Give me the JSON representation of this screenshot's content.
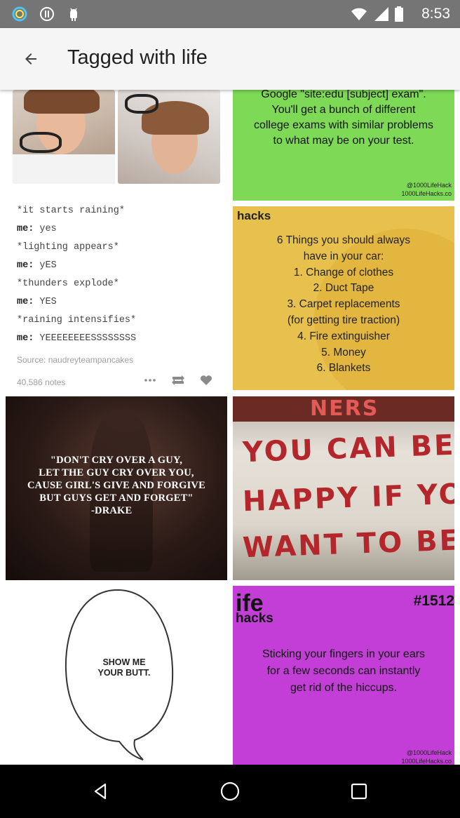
{
  "status_bar": {
    "time": "8:53",
    "icons": [
      "circle-app-icon",
      "pause-circle-icon",
      "android-icon"
    ]
  },
  "app_bar": {
    "back_icon": "arrow-back-icon",
    "title": "Tagged with life"
  },
  "tiles": {
    "green": {
      "lines": [
        "Google \"site:edu [subject] exam\".",
        "You'll get a bunch of different",
        "college exams with similar problems",
        "to what may be on your test."
      ],
      "credit_handle": "@1000LifeHack",
      "credit_site": "1000LifeHacks.co"
    },
    "tumblr_post": {
      "lines": [
        {
          "prefix": "",
          "text": "*it starts raining*"
        },
        {
          "prefix": "me:",
          "text": " yes"
        },
        {
          "prefix": "",
          "text": "*lighting appears*"
        },
        {
          "prefix": "me:",
          "text": " yES"
        },
        {
          "prefix": "",
          "text": "*thunders explode*"
        },
        {
          "prefix": "me:",
          "text": " YES"
        },
        {
          "prefix": "",
          "text": "*raining intensifies*"
        },
        {
          "prefix": "me:",
          "text": " YEEEEEEEESSSSSSSS"
        }
      ],
      "source": "Source: naudreyteampancakes",
      "notes": "40,586 notes"
    },
    "yellow": {
      "header": "hacks",
      "lines": [
        "6 Things you should always",
        "have in your car:",
        "1. Change of clothes",
        "2. Duct Tape",
        "3. Carpet replacements",
        "(for getting tire traction)",
        "4. Fire extinguisher",
        "5. Money",
        "6. Blankets"
      ]
    },
    "drake": {
      "lines": [
        "\"DON'T CRY OVER A GUY,",
        "LET THE GUY CRY OVER YOU,",
        "CAUSE GIRL'S GIVE AND FORGIVE",
        "BUT GUYS GET AND FORGET\"",
        "-DRAKE"
      ]
    },
    "sign": {
      "top": "NERS",
      "lines": [
        "YOU CAN BE",
        "HAPPY IF YOU",
        "WANT TO BE"
      ]
    },
    "bubble": {
      "lines": [
        "SHOW ME",
        "YOUR BUTT."
      ]
    },
    "pink": {
      "title": "ife",
      "subtitle": "hacks",
      "number": "#1512",
      "lines": [
        "Sticking your fingers in your ears",
        "for a few seconds can instantly",
        "get rid of the hiccups."
      ],
      "credit_handle": "@1000LifeHack",
      "credit_site": "1000LifeHacks.co"
    }
  },
  "nav_bar": {
    "icons": [
      "back-triangle-icon",
      "home-circle-icon",
      "recents-square-icon"
    ]
  },
  "colors": {
    "status_bar": "#757575",
    "app_bar": "#f5f5f5",
    "green_tile": "#7ed957",
    "yellow_tile": "#e8c04d",
    "pink_tile": "#c23ed6",
    "sign_red": "#b3262b",
    "nav_bar": "#000000"
  }
}
